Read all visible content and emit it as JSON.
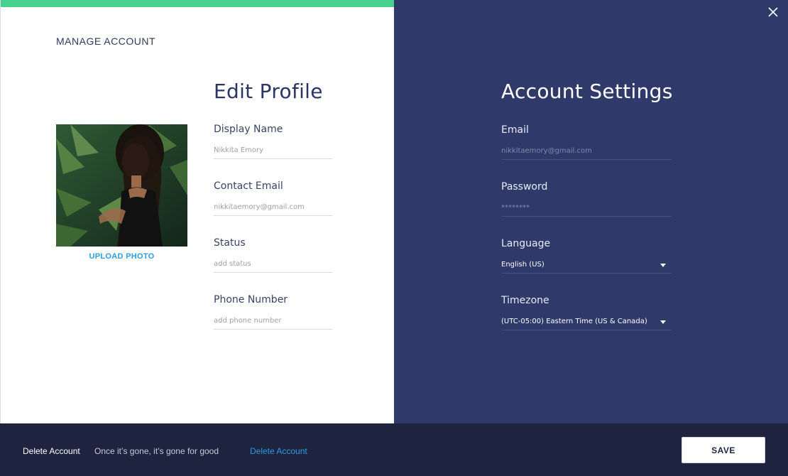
{
  "header": {
    "title": "MANAGE ACCOUNT",
    "progress_percent": 100
  },
  "profile": {
    "heading": "Edit Profile",
    "upload_label": "UPLOAD PHOTO",
    "fields": [
      {
        "label": "Display Name",
        "value": "Nikkita Emory"
      },
      {
        "label": "Contact Email",
        "value": "nikkitaemory@gmail.com"
      },
      {
        "label": "Status",
        "placeholder": "add status"
      },
      {
        "label": "Phone Number",
        "placeholder": "add phone number"
      }
    ]
  },
  "settings": {
    "heading": "Account Settings",
    "email": {
      "label": "Email",
      "value": "nikkitaemory@gmail.com"
    },
    "password": {
      "label": "Password",
      "value": "********"
    },
    "language": {
      "label": "Language",
      "value": "English (US)"
    },
    "timezone": {
      "label": "Timezone",
      "value": "(UTC-05:00) Eastern Time (US & Canada)"
    }
  },
  "footer": {
    "delete_label": "Delete Account",
    "delete_note": "Once it’s gone, it’s gone for good",
    "delete_link": "Delete Account",
    "save_label": "SAVE"
  },
  "colors": {
    "accent_green": "#48d18c",
    "link_blue": "#2f9be0",
    "panel_navy": "#2f3a6b",
    "footer_navy": "#1e2440"
  },
  "icons": {
    "close": "close-icon",
    "caret": "chevron-down-icon"
  }
}
